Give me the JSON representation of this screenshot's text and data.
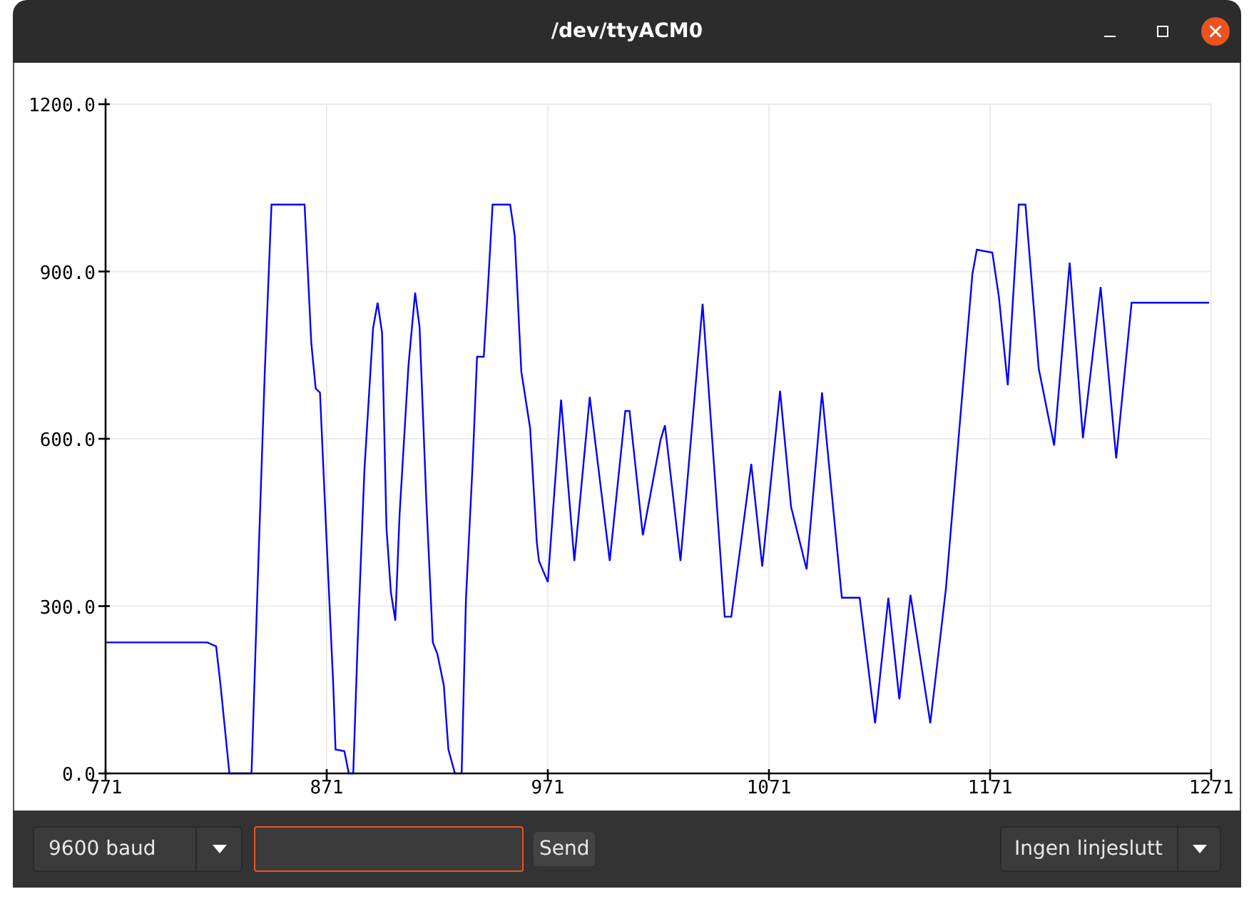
{
  "window": {
    "title": "/dev/ttyACM0"
  },
  "plot": {
    "chart_data": {
      "type": "line",
      "x": [
        771,
        817,
        821,
        823,
        827,
        837,
        840,
        843,
        846,
        848,
        861,
        864,
        866,
        868,
        871,
        874,
        875,
        879,
        881,
        883,
        885,
        888,
        892,
        894,
        896,
        898,
        900,
        902,
        904,
        908,
        911,
        913,
        916,
        919,
        921,
        924,
        926,
        929,
        932,
        934,
        937,
        939,
        942,
        944,
        946,
        954,
        956,
        959,
        963,
        966,
        967,
        971,
        977,
        983,
        990,
        999,
        1006,
        1008,
        1014,
        1022,
        1024,
        1031,
        1041,
        1051,
        1054,
        1063,
        1068,
        1076,
        1081,
        1088,
        1095,
        1104,
        1112,
        1119,
        1125,
        1130,
        1135,
        1144,
        1151,
        1163,
        1165,
        1172,
        1175,
        1179,
        1184,
        1187,
        1193,
        1200,
        1207,
        1213,
        1221,
        1228,
        1235,
        1270
      ],
      "series": [
        {
          "color": "#0000ff",
          "values": [
            235,
            235,
            228,
            158,
            0,
            0,
            363,
            720,
            1020,
            1020,
            1020,
            772,
            690,
            683,
            414,
            158,
            43,
            40,
            0,
            0,
            235,
            542,
            798,
            844,
            790,
            440,
            325,
            274,
            465,
            734,
            862,
            800,
            491,
            235,
            215,
            158,
            43,
            0,
            0,
            312,
            555,
            747,
            747,
            875,
            1020,
            1020,
            964,
            721,
            619,
            414,
            381,
            343,
            670,
            381,
            675,
            381,
            650,
            650,
            427,
            599,
            624,
            381,
            842,
            281,
            281,
            555,
            371,
            686,
            478,
            366,
            683,
            315,
            315,
            90,
            315,
            133,
            320,
            90,
            330,
            895,
            939,
            934,
            854,
            696,
            1020,
            1020,
            726,
            588,
            916,
            601,
            872,
            565,
            844,
            844
          ]
        }
      ],
      "grid": true,
      "xlim": [
        771,
        1271
      ],
      "ylim": [
        0,
        1200
      ],
      "xticks": [
        771,
        871,
        971,
        1071,
        1171,
        1271
      ],
      "yticks": [
        {
          "value": 0,
          "label": "0.0"
        },
        {
          "value": 300,
          "label": "300.0"
        },
        {
          "value": 600,
          "label": "600.0"
        },
        {
          "value": 900,
          "label": "900.0"
        },
        {
          "value": 1200,
          "label": "1200.0"
        }
      ]
    }
  },
  "bottom_bar": {
    "baud_rate": "9600 baud",
    "send_button": "Send",
    "line_ending": "Ingen linjeslutt"
  }
}
